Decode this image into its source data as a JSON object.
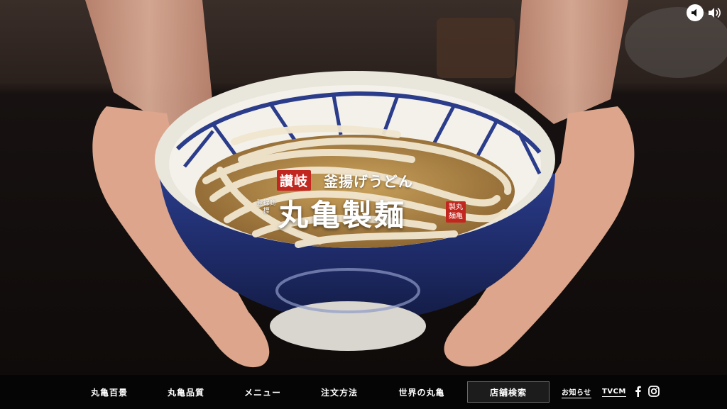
{
  "logo": {
    "region": "讃岐",
    "product": "釜揚げうどん",
    "side_text": "登録商標",
    "brand": "丸亀製麺",
    "seal": "製丸麺亀"
  },
  "nav": {
    "items": [
      {
        "label": "丸亀百景"
      },
      {
        "label": "丸亀品質"
      },
      {
        "label": "メニュー"
      },
      {
        "label": "注文方法"
      },
      {
        "label": "世界の丸亀"
      },
      {
        "label": "店舗検索"
      }
    ],
    "news_label": "お知らせ",
    "tvcm_label": "TVCM"
  },
  "icons": {
    "mute": "speaker-mute-icon",
    "volume": "speaker-volume-icon",
    "facebook": "facebook-icon",
    "instagram": "instagram-icon"
  },
  "colors": {
    "accent_red": "#c2271f",
    "nav_background": "#050505",
    "bowl_blue": "#2a3c8a"
  }
}
